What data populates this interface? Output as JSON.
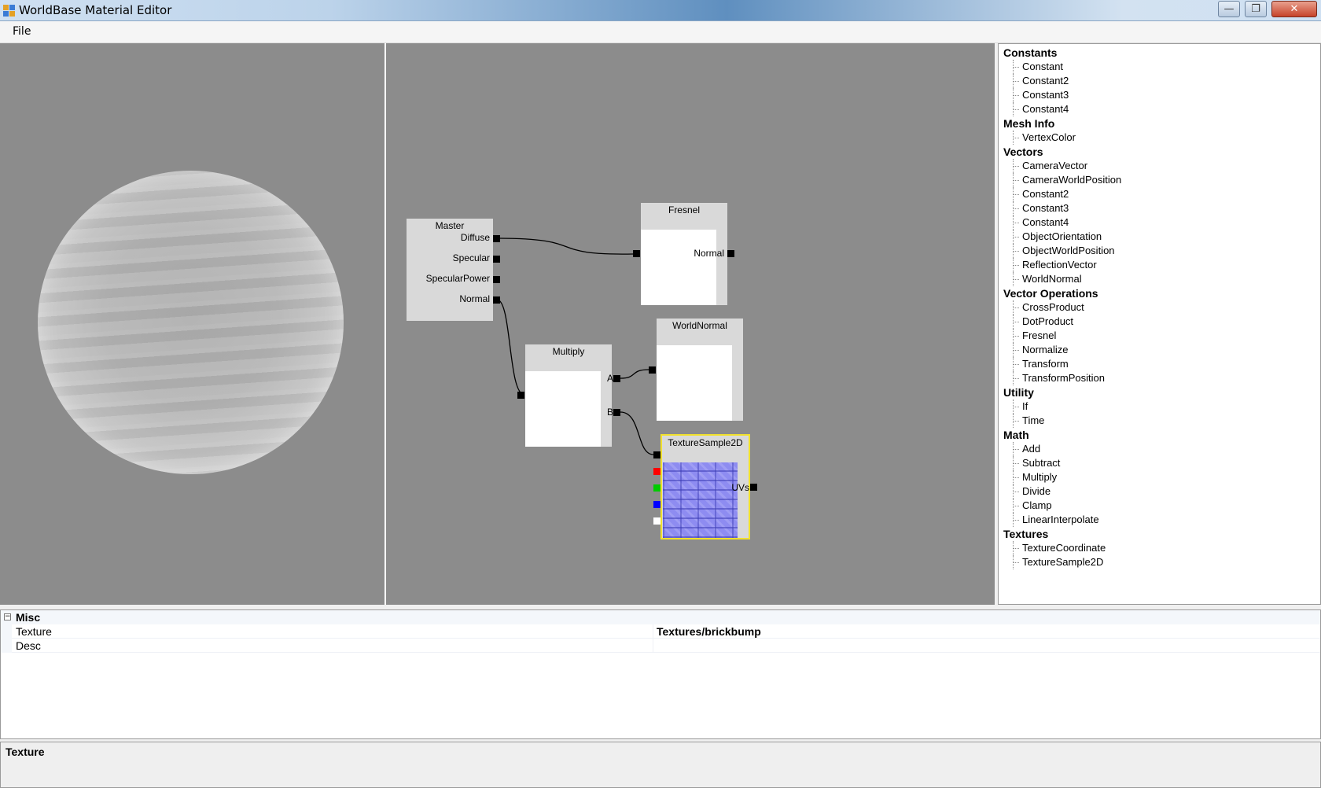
{
  "window": {
    "title": "WorldBase Material Editor",
    "controls": {
      "minimize": "—",
      "restore": "❐",
      "close": "✕"
    }
  },
  "menu": {
    "file": "File"
  },
  "graph": {
    "nodes": {
      "master": {
        "title": "Master",
        "inputs": [
          "Diffuse",
          "Specular",
          "SpecularPower",
          "Normal"
        ]
      },
      "fresnel": {
        "title": "Fresnel",
        "port": "Normal"
      },
      "multiply": {
        "title": "Multiply",
        "port_a": "A",
        "port_b": "B"
      },
      "worldnormal": {
        "title": "WorldNormal"
      },
      "texturesample": {
        "title": "TextureSample2D",
        "port": "UVs",
        "channel_colors": [
          "#ff0000",
          "#00cc00",
          "#0000ff",
          "#ffffff"
        ]
      }
    }
  },
  "toolbox": {
    "groups": [
      {
        "label": "Constants",
        "items": [
          "Constant",
          "Constant2",
          "Constant3",
          "Constant4"
        ]
      },
      {
        "label": "Mesh Info",
        "items": [
          "VertexColor"
        ]
      },
      {
        "label": "Vectors",
        "items": [
          "CameraVector",
          "CameraWorldPosition",
          "Constant2",
          "Constant3",
          "Constant4",
          "ObjectOrientation",
          "ObjectWorldPosition",
          "ReflectionVector",
          "WorldNormal"
        ]
      },
      {
        "label": "Vector Operations",
        "items": [
          "CrossProduct",
          "DotProduct",
          "Fresnel",
          "Normalize",
          "Transform",
          "TransformPosition"
        ]
      },
      {
        "label": "Utility",
        "items": [
          "If",
          "Time"
        ]
      },
      {
        "label": "Math",
        "items": [
          "Add",
          "Subtract",
          "Multiply",
          "Divide",
          "Clamp",
          "LinearInterpolate"
        ]
      },
      {
        "label": "Textures",
        "items": [
          "TextureCoordinate",
          "TextureSample2D"
        ]
      }
    ]
  },
  "properties": {
    "category": "Misc",
    "toggle": "−",
    "rows": [
      {
        "name": "Texture",
        "value": "Textures/brickbump"
      },
      {
        "name": "Desc",
        "value": ""
      }
    ]
  },
  "help": {
    "title": "Texture"
  }
}
